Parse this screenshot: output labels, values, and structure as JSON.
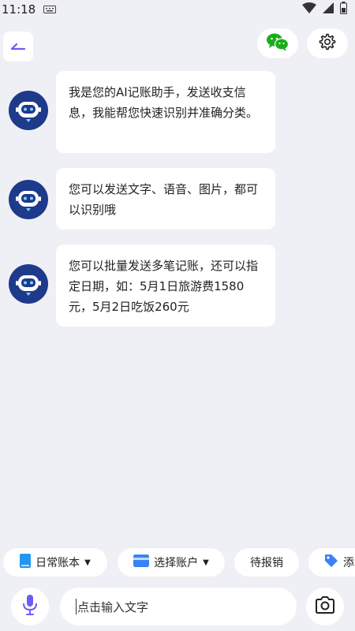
{
  "status_bar": {
    "time": "11:18"
  },
  "header": {
    "back_icon": "back-arrow-icon",
    "wechat_icon": "wechat-icon",
    "settings_icon": "gear-icon"
  },
  "messages": [
    {
      "text": "我是您的AI记账助手，发送收支信息，我能帮您快速识别并准确分类。"
    },
    {
      "text": "您可以发送文字、语音、图片，都可以识别哦"
    },
    {
      "text": "您可以批量发送多笔记账，还可以指定日期，如：5月1日旅游费1580元，5月2日吃饭260元"
    }
  ],
  "chips": [
    {
      "label": "日常账本",
      "icon": "book-icon"
    },
    {
      "label": "选择账户",
      "icon": "card-icon"
    },
    {
      "label": "待报销"
    },
    {
      "label": "添",
      "icon": "tag-icon"
    }
  ],
  "input": {
    "placeholder": "点击输入文字"
  },
  "colors": {
    "accent": "#6b5cf6",
    "wechat": "#1aad19",
    "avatar_bg": "#1e3a8a",
    "background": "#efeff6"
  }
}
